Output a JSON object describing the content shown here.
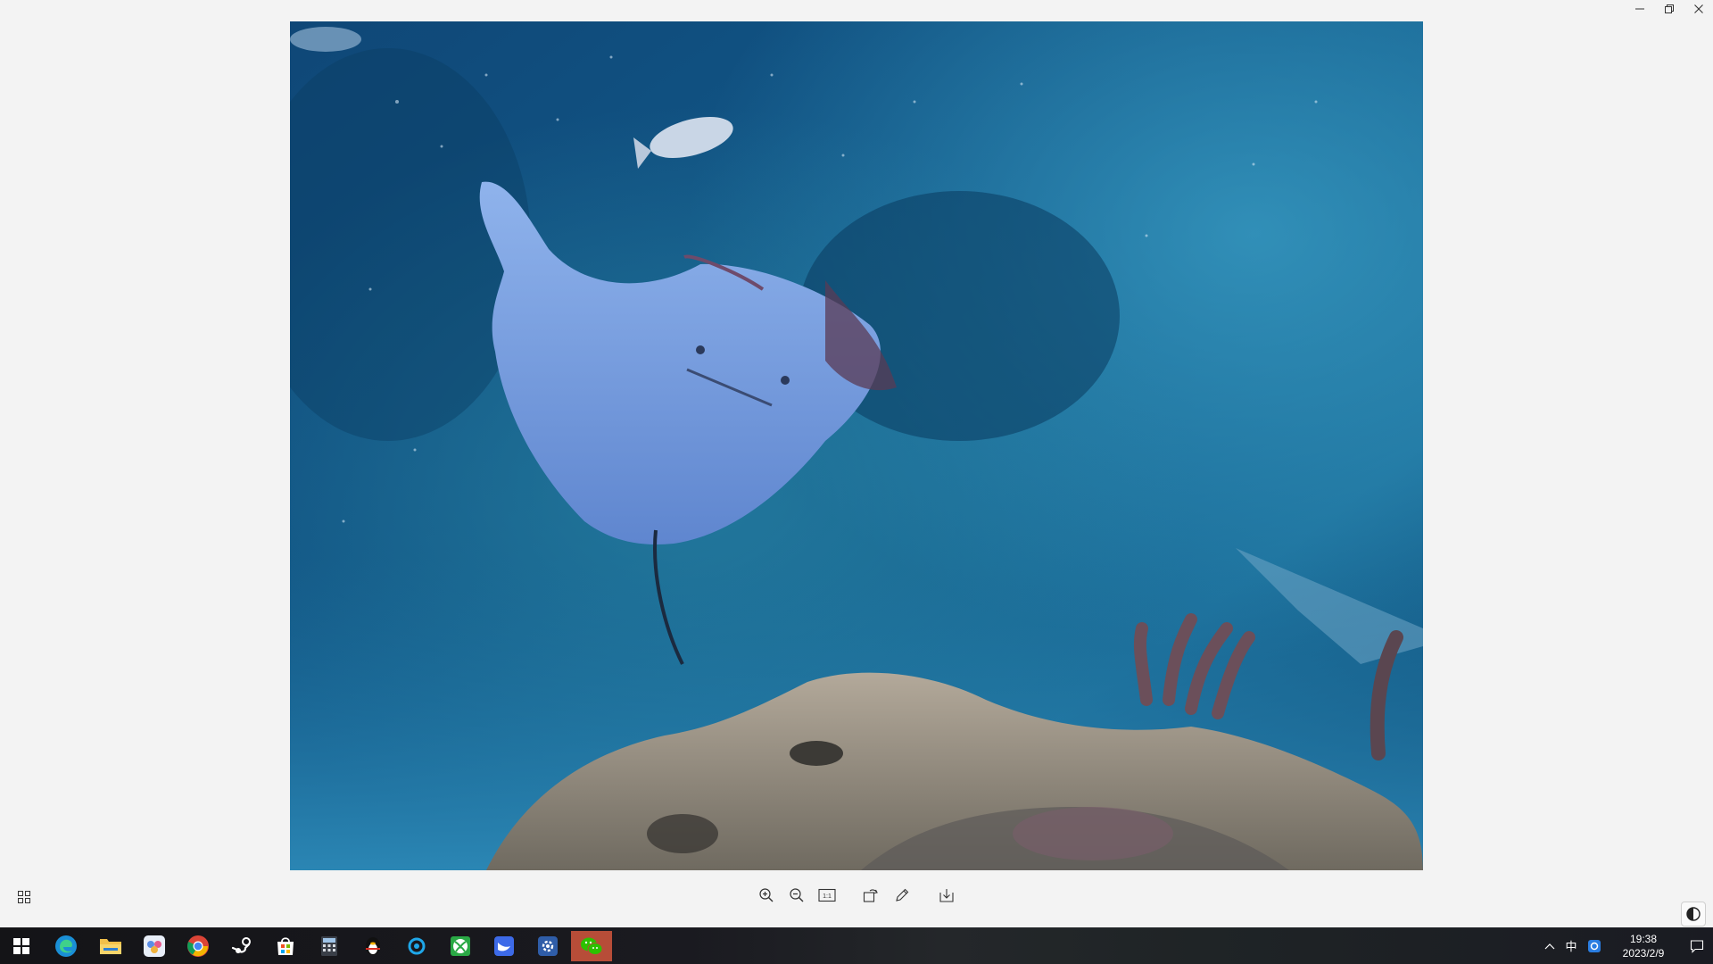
{
  "window": {
    "controls": [
      {
        "name": "minimize",
        "icon": "minimize-icon"
      },
      {
        "name": "restore",
        "icon": "restore-icon"
      },
      {
        "name": "close",
        "icon": "close-icon"
      }
    ]
  },
  "photo": {
    "icon": "photo-content"
  },
  "toolbar": {
    "left": {
      "icon": "filmstrip-grid-icon"
    },
    "tools": [
      {
        "name": "zoom-in",
        "icon": "zoom-in-icon"
      },
      {
        "name": "zoom-out",
        "icon": "zoom-out-icon"
      },
      {
        "name": "actual-size",
        "icon": "actual-size-icon",
        "label": "1:1"
      },
      {
        "name": "rotate",
        "icon": "rotate-icon"
      },
      {
        "name": "edit",
        "icon": "pencil-icon"
      },
      {
        "name": "save",
        "icon": "save-download-icon"
      }
    ],
    "corner": {
      "icon": "theme-toggle-icon"
    }
  },
  "taskbar": {
    "apps": [
      {
        "name": "start",
        "icon": "windows-logo-icon"
      },
      {
        "name": "edge",
        "icon": "edge-browser-icon"
      },
      {
        "name": "file-explorer",
        "icon": "folder-icon"
      },
      {
        "name": "photos",
        "icon": "photos-app-icon"
      },
      {
        "name": "chrome",
        "icon": "chrome-icon"
      },
      {
        "name": "steam",
        "icon": "steam-icon"
      },
      {
        "name": "store",
        "icon": "store-icon"
      },
      {
        "name": "calculator",
        "icon": "calculator-icon"
      },
      {
        "name": "qq",
        "icon": "penguin-icon"
      },
      {
        "name": "app-ring",
        "icon": "ring-app-icon"
      },
      {
        "name": "xbox",
        "icon": "xbox-icon"
      },
      {
        "name": "feishu",
        "icon": "bird-app-icon"
      },
      {
        "name": "settings-tool",
        "icon": "gear-app-icon"
      },
      {
        "name": "wechat",
        "icon": "wechat-icon",
        "active": true
      }
    ],
    "tray": {
      "chevron": "chevron-up-icon",
      "ime": "中",
      "app": "tray-app-icon",
      "time": "19:38",
      "date": "2023/2/9",
      "notifications": "notification-icon"
    }
  },
  "colors": {
    "background": "#f3f3f3",
    "taskbar": "#1a1a20",
    "active_app": "#b74d38",
    "water_deep": "#0b3f6e",
    "water_light": "#2a86b0"
  }
}
